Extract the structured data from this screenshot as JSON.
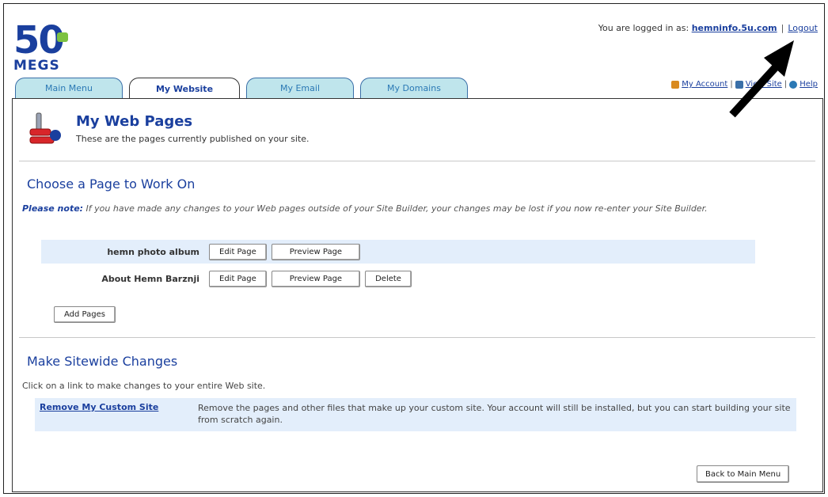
{
  "brand": {
    "digits": "50",
    "megs": "MEGS"
  },
  "login": {
    "prefix": "You are logged in as:",
    "user": "hemninfo.5u.com",
    "separator": "|",
    "logout": "Logout"
  },
  "util": {
    "account": "My Account",
    "website": "View Site",
    "help": "Help"
  },
  "tabs": [
    {
      "label": "Main Menu"
    },
    {
      "label": "My Website"
    },
    {
      "label": "My Email"
    },
    {
      "label": "My Domains"
    }
  ],
  "header": {
    "title": "My Web Pages",
    "subtitle": "These are the pages currently published on your site."
  },
  "choose": {
    "title": "Choose a Page to Work On",
    "note_label": "Please note:",
    "note_text": " If you have made any changes to your Web pages outside of your Site Builder, your changes may be lost if you now re-enter your Site Builder.",
    "pages": [
      {
        "name": "hemn photo album",
        "edit": "Edit Page",
        "preview": "Preview Page"
      },
      {
        "name": "About Hemn Barznji",
        "edit": "Edit Page",
        "preview": "Preview Page",
        "delete": "Delete"
      }
    ],
    "add_pages": "Add Pages"
  },
  "sitewide": {
    "title": "Make Sitewide Changes",
    "intro": "Click on a link to make changes to your entire Web site.",
    "remove_link": "Remove My Custom Site",
    "remove_desc": "Remove the pages and other files that make up your custom site. Your account will still be installed, but you can start building your site from scratch again."
  },
  "back_button": "Back to Main Menu",
  "colors": {
    "brand_blue": "#1a3f9e",
    "tab_bg": "#bfe5ec",
    "row_shade": "#e3eefb",
    "logo_green": "#7dc242"
  }
}
